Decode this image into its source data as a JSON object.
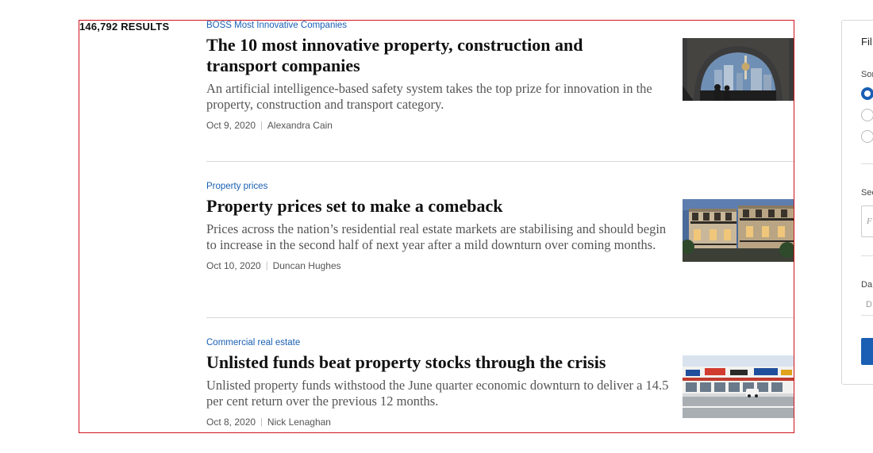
{
  "results": {
    "count_label": "146,792 RESULTS"
  },
  "articles": [
    {
      "kicker": "BOSS Most Innovative Companies",
      "headline": "The 10 most innovative property, construction and transport companies",
      "summary": "An artificial intelligence-based safety system takes the top prize for innovation in the property, construction and transport category.",
      "date": "Oct 9, 2020",
      "author": "Alexandra Cain"
    },
    {
      "kicker": "Property prices",
      "headline": "Property prices set to make a comeback",
      "summary": "Prices across the nation’s residential real estate markets are stabilising and should begin to increase in the second half of next year after a mild downturn over coming months.",
      "date": "Oct 10, 2020",
      "author": "Duncan Hughes"
    },
    {
      "kicker": "Commercial real estate",
      "headline": "Unlisted funds beat property stocks through the crisis",
      "summary": "Unlisted property funds withstood the June quarter economic downturn to deliver a 14.5 per cent return over the previous 12 months.",
      "date": "Oct 8, 2020",
      "author": "Nick Lenaghan"
    }
  ],
  "filters": {
    "title": "Fil",
    "sort_label": "Sor",
    "section_label": "Sec",
    "section_placeholder": "F",
    "date_label": "Da",
    "date_placeholder": "D"
  },
  "colors": {
    "accent": "#1a5fb4",
    "frame": "#d0141e"
  }
}
